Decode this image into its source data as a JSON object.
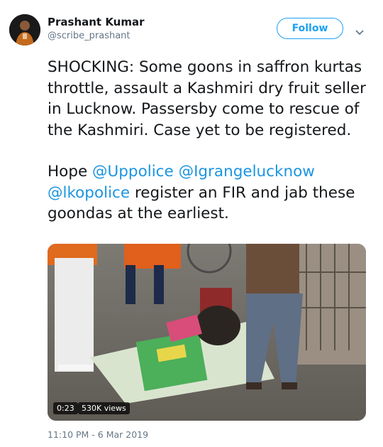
{
  "author": {
    "name": "Prashant Kumar",
    "handle": "@scribe_prashant",
    "avatar_icon": "user-avatar-photo"
  },
  "follow_button": {
    "label": "Follow"
  },
  "menu_icon": "chevron-down-icon",
  "tweet": {
    "paragraph1": "SHOCKING: Some goons in saffron kurtas throttle, assault a Kashmiri dry fruit seller in Lucknow. Passersby come to rescue of the Kashmiri. Case yet to be registered.",
    "paragraph2_prefix": "Hope ",
    "mentions": [
      "@Uppolice",
      "@Igrangelucknow",
      "@lkopolice"
    ],
    "paragraph2_suffix": " register an FIR and jab these goondas at the earliest."
  },
  "video": {
    "duration": "0:23",
    "views": "530K views"
  },
  "timestamp": "11:10 PM - 6 Mar 2019",
  "colors": {
    "accent": "#1da1f2",
    "mention": "#1b95e0",
    "secondary_text": "#657786"
  }
}
